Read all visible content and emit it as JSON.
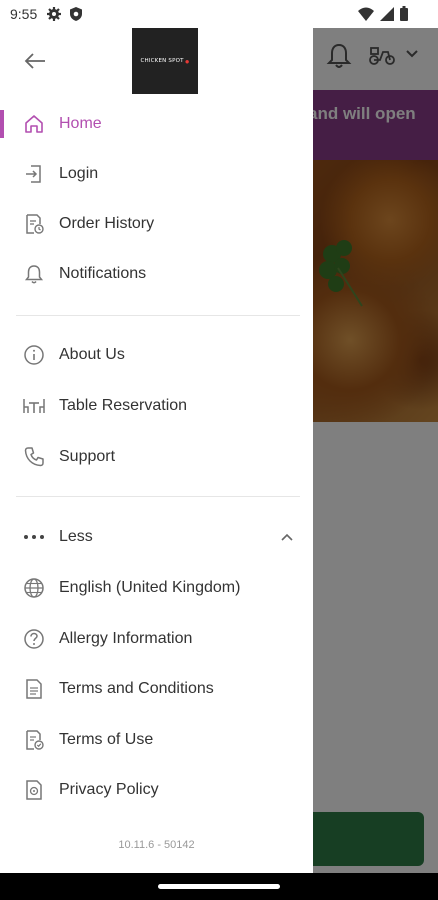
{
  "status_bar": {
    "time": "9:55",
    "left_icons": [
      "gear-icon",
      "shield-icon"
    ],
    "right_icons": [
      "wifi-icon",
      "signal-icon",
      "battery-icon"
    ]
  },
  "background_app": {
    "banner_text": "and will open",
    "header_icons": [
      "bell-icon",
      "scooter-icon",
      "chevron-down-icon"
    ]
  },
  "drawer": {
    "logo_text": "CHICKEN SPOT",
    "menu_primary": [
      {
        "label": "Home",
        "icon": "home-icon",
        "active": true
      },
      {
        "label": "Login",
        "icon": "login-icon",
        "active": false
      },
      {
        "label": "Order History",
        "icon": "order-history-icon",
        "active": false
      },
      {
        "label": "Notifications",
        "icon": "bell-icon",
        "active": false
      }
    ],
    "menu_secondary": [
      {
        "label": "About Us",
        "icon": "info-icon"
      },
      {
        "label": "Table Reservation",
        "icon": "table-icon"
      },
      {
        "label": "Support",
        "icon": "phone-icon"
      }
    ],
    "less_toggle": {
      "label": "Less",
      "icon": "more-dots-icon",
      "chevron": "chevron-up-icon"
    },
    "menu_tertiary": [
      {
        "label": "English (United Kingdom)",
        "icon": "globe-icon"
      },
      {
        "label": "Allergy Information",
        "icon": "question-circle-icon"
      },
      {
        "label": "Terms and Conditions",
        "icon": "document-icon"
      },
      {
        "label": "Terms of Use",
        "icon": "document-check-icon"
      },
      {
        "label": "Privacy Policy",
        "icon": "privacy-icon"
      }
    ],
    "version": "10.11.6 - 50142"
  },
  "colors": {
    "accent": "#b24fb0",
    "icon": "#777777",
    "text": "#333333",
    "banner": "#8a3d8a",
    "cta": "#2e7d46"
  }
}
